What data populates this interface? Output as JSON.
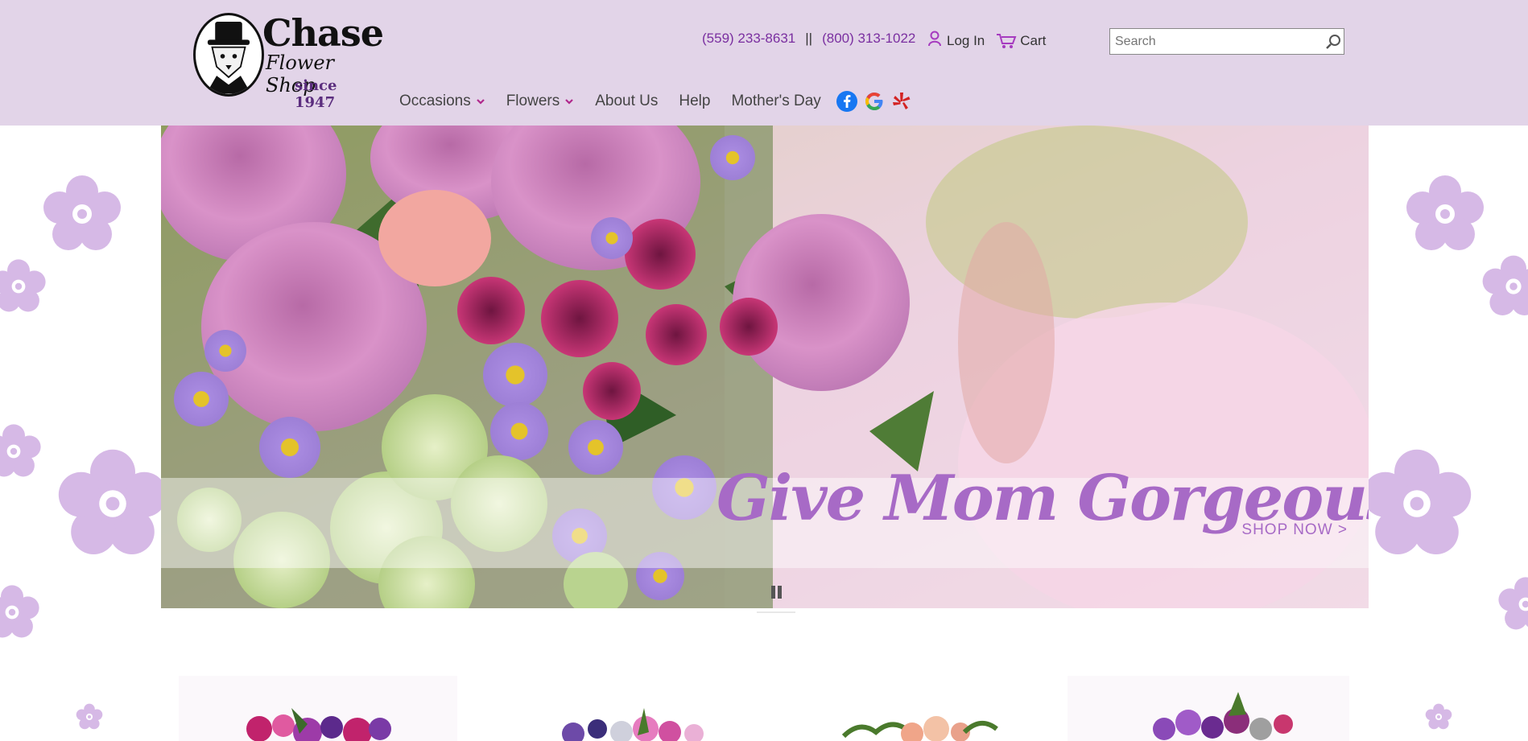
{
  "header": {
    "logo": {
      "brand": "Chase",
      "subtitle": "Flower Shop",
      "since": "since 1947"
    },
    "phones": [
      "(559) 233-8631",
      "(800) 313-1022"
    ],
    "phone_separator": "||",
    "login_label": "Log In",
    "cart_label": "Cart",
    "search_placeholder": "Search"
  },
  "nav": {
    "items": [
      {
        "label": "Occasions",
        "dropdown": true
      },
      {
        "label": "Flowers",
        "dropdown": true
      },
      {
        "label": "About Us",
        "dropdown": false
      },
      {
        "label": "Help",
        "dropdown": false
      },
      {
        "label": "Mother's Day",
        "dropdown": false
      }
    ],
    "social_icons": [
      "facebook-icon",
      "google-icon",
      "yelp-icon"
    ]
  },
  "hero": {
    "title": "Give Mom Gorgeous",
    "cta": "SHOP NOW >"
  },
  "colors": {
    "header_bg": "#e2d4e8",
    "accent_purple": "#7a2fa0",
    "hero_text": "#a76ac6",
    "bg_flower": "#d6b9e6"
  }
}
